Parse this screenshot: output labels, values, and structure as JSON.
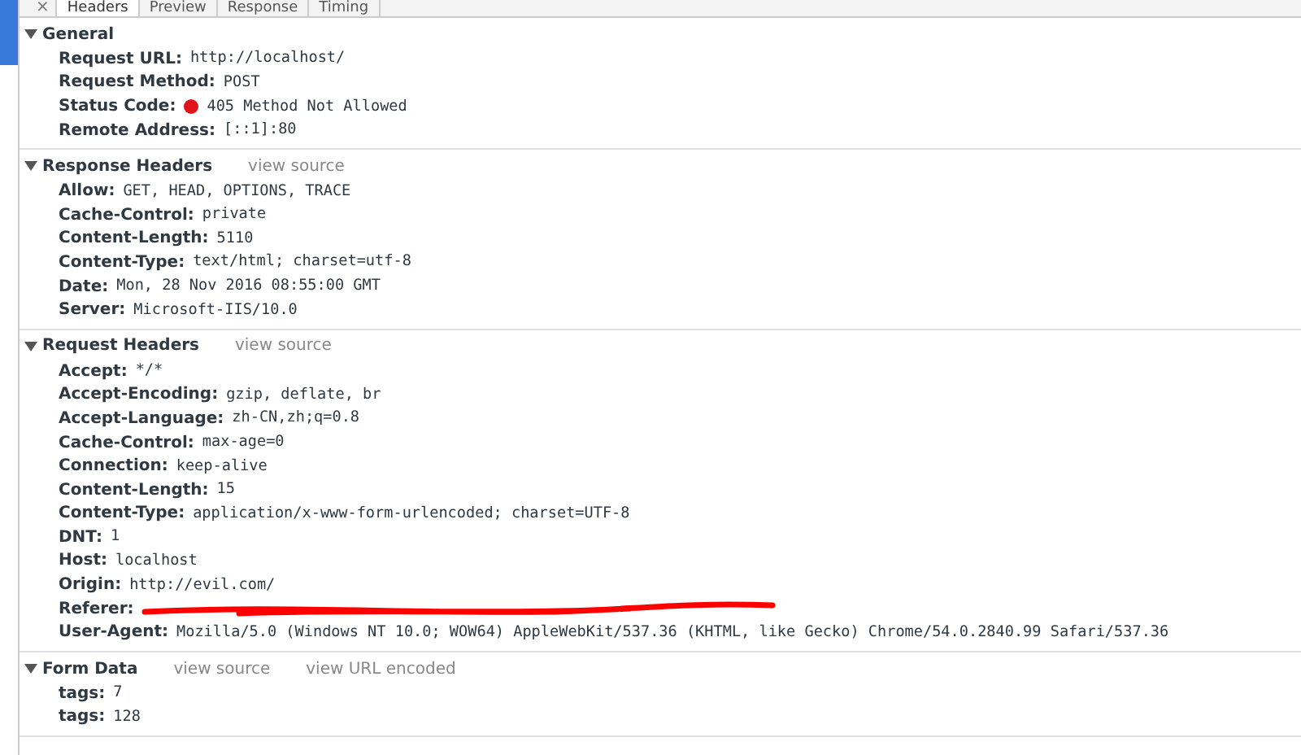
{
  "tabs": [
    {
      "label": "×",
      "kind": "close",
      "selected": false
    },
    {
      "label": "Headers",
      "kind": "tab",
      "selected": true
    },
    {
      "label": "Preview",
      "kind": "tab",
      "selected": false
    },
    {
      "label": "Response",
      "kind": "tab",
      "selected": false
    },
    {
      "label": "Timing",
      "kind": "tab",
      "selected": false
    }
  ],
  "sections": [
    {
      "title": "General",
      "expanded": true,
      "rows": [
        {
          "name": "Request URL:",
          "value": "http://localhost/"
        },
        {
          "name": "Request Method:",
          "value": "POST"
        },
        {
          "name": "Status Code:",
          "value": "405 Method Not Allowed",
          "color": "#e0131b"
        },
        {
          "name": "Remote Address:",
          "value": "[::1]:80"
        }
      ]
    },
    {
      "title": "Response Headers",
      "expanded": true,
      "links": [
        "view source"
      ],
      "rows": [
        {
          "name": "Allow:",
          "value": "GET, HEAD, OPTIONS, TRACE"
        },
        {
          "name": "Cache-Control:",
          "value": "private"
        },
        {
          "name": "Content-Length:",
          "value": "5110"
        },
        {
          "name": "Content-Type:",
          "value": "text/html; charset=utf-8"
        },
        {
          "name": "Date:",
          "value": "Mon, 28 Nov 2016 08:55:00 GMT"
        },
        {
          "name": "Server:",
          "value": "Microsoft-IIS/10.0"
        }
      ]
    },
    {
      "title": "Request Headers",
      "expanded": true,
      "links": [
        "view source"
      ],
      "rows": [
        {
          "name": "Accept:",
          "value": "*/*"
        },
        {
          "name": "Accept-Encoding:",
          "value": "gzip, deflate, br"
        },
        {
          "name": "Accept-Language:",
          "value": "zh-CN,zh;q=0.8"
        },
        {
          "name": "Cache-Control:",
          "value": "max-age=0"
        },
        {
          "name": "Connection:",
          "value": "keep-alive"
        },
        {
          "name": "Content-Length:",
          "value": "15"
        },
        {
          "name": "Content-Type:",
          "value": "application/x-www-form-urlencoded; charset=UTF-8"
        },
        {
          "name": "DNT:",
          "value": "1"
        },
        {
          "name": "Host:",
          "value": "localhost"
        },
        {
          "name": "Origin:",
          "value": "http://evil.com/"
        },
        {
          "name": "Referer:",
          "redacted": true
        },
        {
          "name": "User-Agent:",
          "value": "Mozilla/5.0 (Windows NT 10.0; WOW64) AppleWebKit/537.36 (KHTML, like Gecko) Chrome/54.0.2840.99 Safari/537.36"
        }
      ]
    },
    {
      "title": "Form Data",
      "expanded": true,
      "links": [
        "view source",
        "view URL encoded"
      ],
      "rows": [
        {
          "name": "tags:",
          "value": "7"
        },
        {
          "name": "tags:",
          "value": "128"
        }
      ]
    }
  ]
}
